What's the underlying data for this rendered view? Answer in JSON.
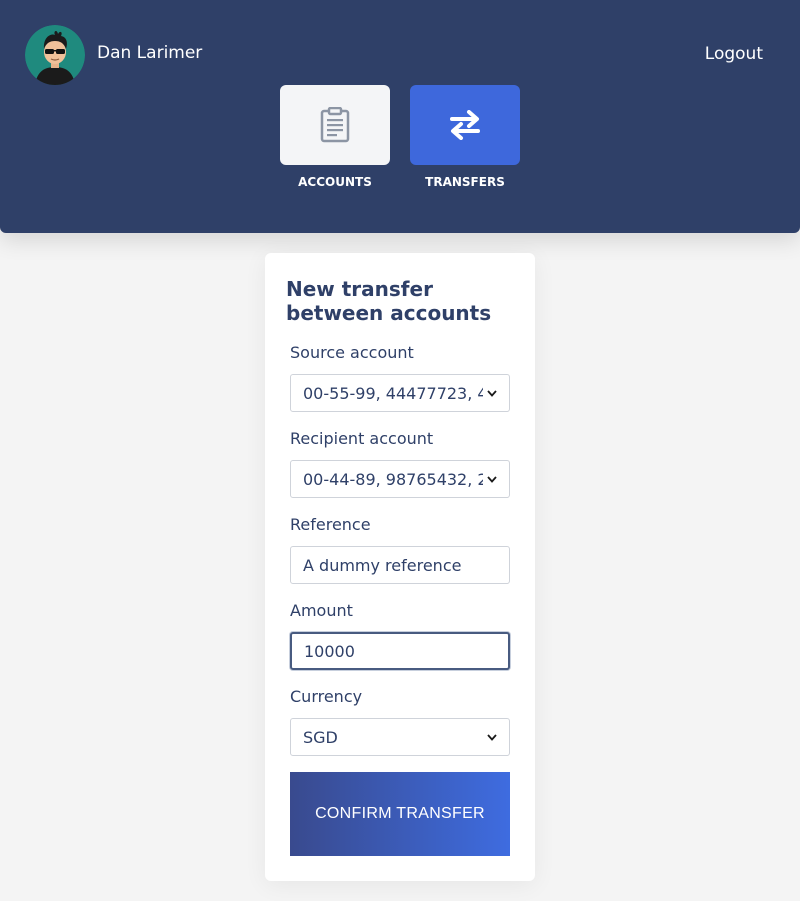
{
  "user": {
    "name": "Dan Larimer"
  },
  "header": {
    "logout_label": "Logout"
  },
  "nav": {
    "tiles": [
      {
        "label": "ACCOUNTS",
        "icon": "clipboard-icon",
        "active": false
      },
      {
        "label": "TRANSFERS",
        "icon": "transfer-arrows-icon",
        "active": true
      }
    ]
  },
  "form": {
    "title": "New transfer between accounts",
    "source": {
      "label": "Source account",
      "value": "00-55-99, 44477723, 4"
    },
    "recipient": {
      "label": "Recipient account",
      "value": "00-44-89, 98765432, 2"
    },
    "reference": {
      "label": "Reference",
      "value": "A dummy reference"
    },
    "amount": {
      "label": "Amount",
      "value": "10000"
    },
    "currency": {
      "label": "Currency",
      "value": "SGD"
    },
    "confirm_label": "CONFIRM TRANSFER"
  },
  "colors": {
    "header_bg": "#2f4068",
    "active_tile": "#3e68dc",
    "text_primary": "#2f4068",
    "button_gradient_start": "#394a8e",
    "button_gradient_end": "#3e6ce0"
  }
}
